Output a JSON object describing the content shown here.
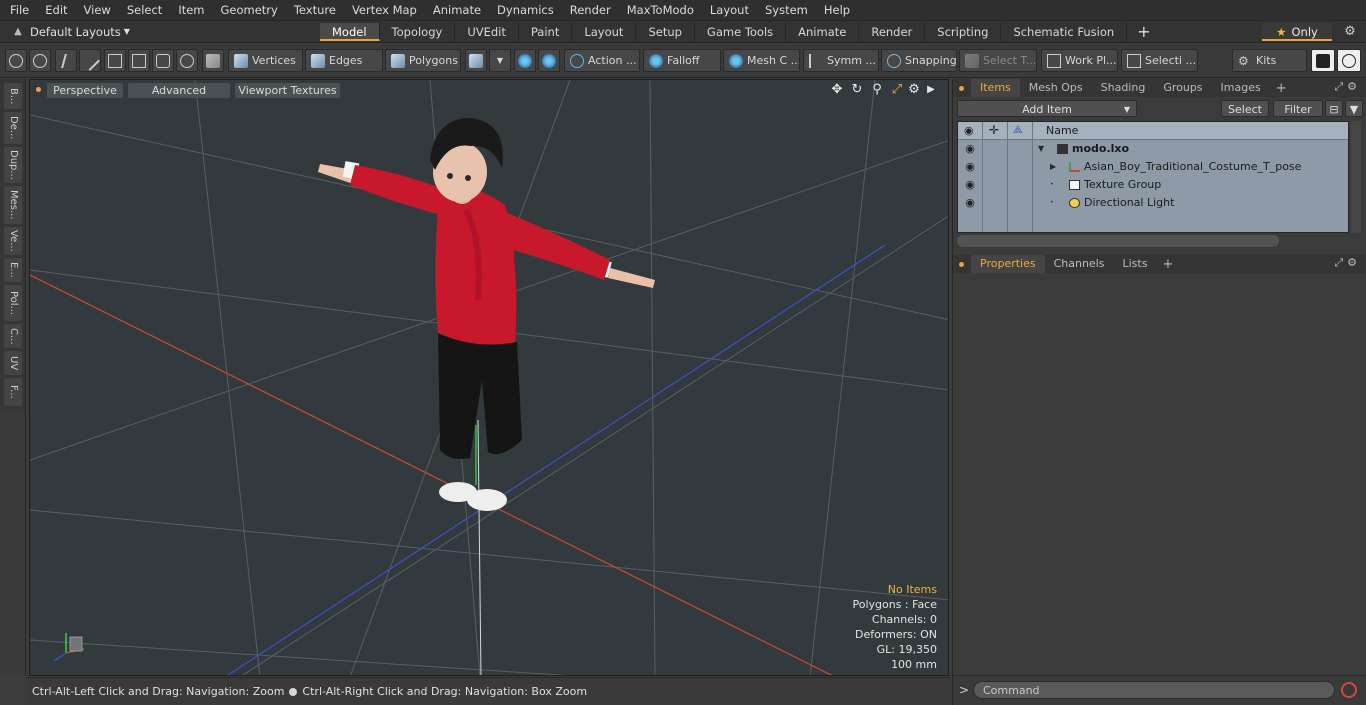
{
  "menubar": [
    "File",
    "Edit",
    "View",
    "Select",
    "Item",
    "Geometry",
    "Texture",
    "Vertex Map",
    "Animate",
    "Dynamics",
    "Render",
    "MaxToModo",
    "Layout",
    "System",
    "Help"
  ],
  "tabbar": {
    "layout_label": "Default Layouts",
    "tabs": [
      "Model",
      "Topology",
      "UVEdit",
      "Paint",
      "Layout",
      "Setup",
      "Game Tools",
      "Animate",
      "Render",
      "Scripting",
      "Schematic Fusion"
    ],
    "active_tab": "Model",
    "only_label": "Only"
  },
  "toolbar": {
    "vertices": "Vertices",
    "edges": "Edges",
    "polygons": "Polygons",
    "action": "Action ...",
    "falloff": "Falloff",
    "mesh": "Mesh C ...",
    "symm": "Symm ...",
    "snapping": "Snapping",
    "select_t": "Select T...",
    "work_pl": "Work Pl...",
    "selecti": "Selecti ...",
    "kits": "Kits"
  },
  "left_tabs": [
    "B...",
    "De...",
    "Dup...",
    "Mes...",
    "Ve...",
    "E...",
    "Pol...",
    "C...",
    "UV",
    "F..."
  ],
  "viewport": {
    "view_mode": "Perspective",
    "advanced": "Advanced",
    "textures": "Viewport Textures",
    "info": {
      "no_items": "No Items",
      "polygons": "Polygons : Face",
      "channels": "Channels: 0",
      "deformers": "Deformers: ON",
      "gl": "GL: 19,350",
      "scale": "100 mm"
    }
  },
  "status": {
    "left": "Ctrl-Alt-Left Click and Drag: Navigation: Zoom",
    "right": "Ctrl-Alt-Right Click and Drag: Navigation: Box Zoom"
  },
  "items_panel": {
    "tabs": [
      "Items",
      "Mesh Ops",
      "Shading",
      "Groups",
      "Images"
    ],
    "active_tab": "Items",
    "add_item": "Add Item",
    "select": "Select",
    "filter": "Filter",
    "col_name": "Name",
    "rows": [
      {
        "name": "modo.lxo"
      },
      {
        "name": "Asian_Boy_Traditional_Costume_T_pose"
      },
      {
        "name": "Texture Group"
      },
      {
        "name": "Directional Light"
      }
    ]
  },
  "props_panel": {
    "tabs": [
      "Properties",
      "Channels",
      "Lists"
    ],
    "active_tab": "Properties"
  },
  "command": {
    "prompt": ">",
    "placeholder": "Command"
  },
  "colors": {
    "accent": "#e8a33b",
    "viewport_bg": "#323a3d",
    "x_axis": "#c8453a",
    "z_axis": "#3d4fc4",
    "jacket": "#c8182c"
  }
}
